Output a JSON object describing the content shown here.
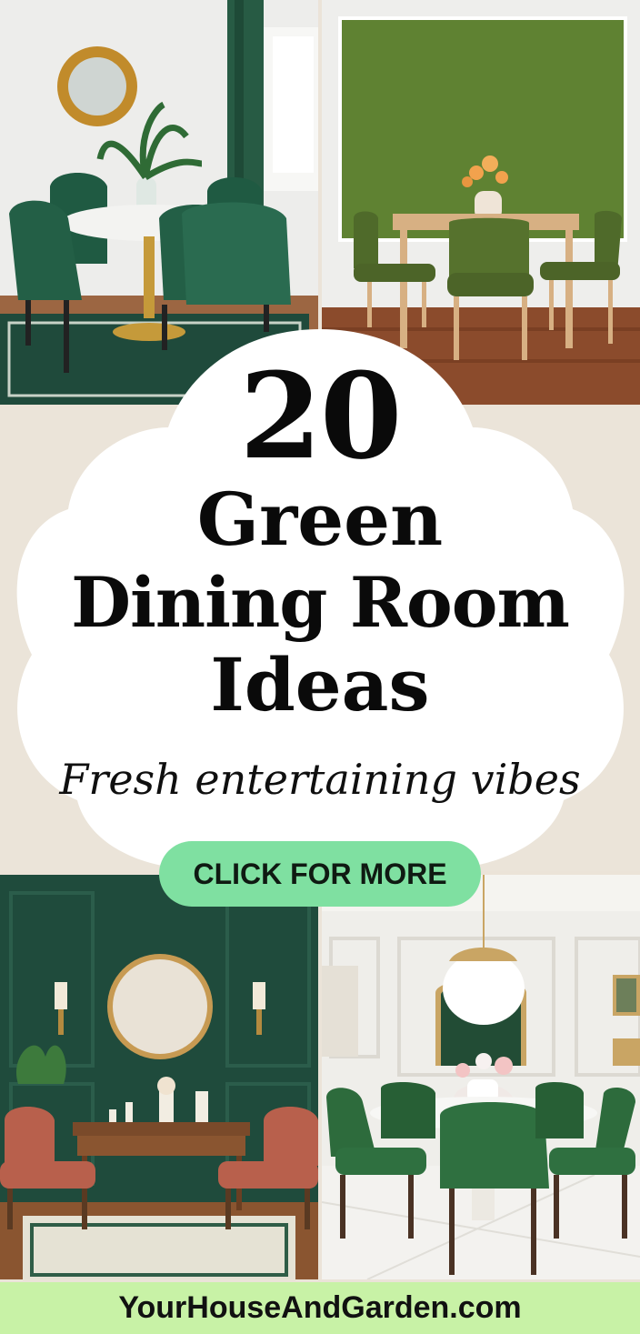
{
  "pin": {
    "title_number": "20",
    "title_line_1": "Green",
    "title_line_2": "Dining Room",
    "title_line_3": "Ideas",
    "subtitle": "Fresh entertaining vibes",
    "cta_label": "CLICK FOR MORE",
    "footer_url": "YourHouseAndGarden.com"
  },
  "colors": {
    "cta_background": "#7fe0a1",
    "footer_background": "#c8f2a6",
    "band_background": "#ebe4d9",
    "blob_fill": "#ffffff",
    "title_text": "#0a0a0a"
  },
  "photos": [
    {
      "position": "top-left",
      "subject": "round marble table with dark green velvet chairs and gold sunburst mirror"
    },
    {
      "position": "top-right",
      "subject": "wooden table with olive green chairs against olive green wall"
    },
    {
      "position": "bottom-left",
      "subject": "dark green paneled wall with round mirror, wooden console and terracotta chairs"
    },
    {
      "position": "bottom-right",
      "subject": "white paneled room with round table, green velvet chairs and globe pendant"
    }
  ]
}
